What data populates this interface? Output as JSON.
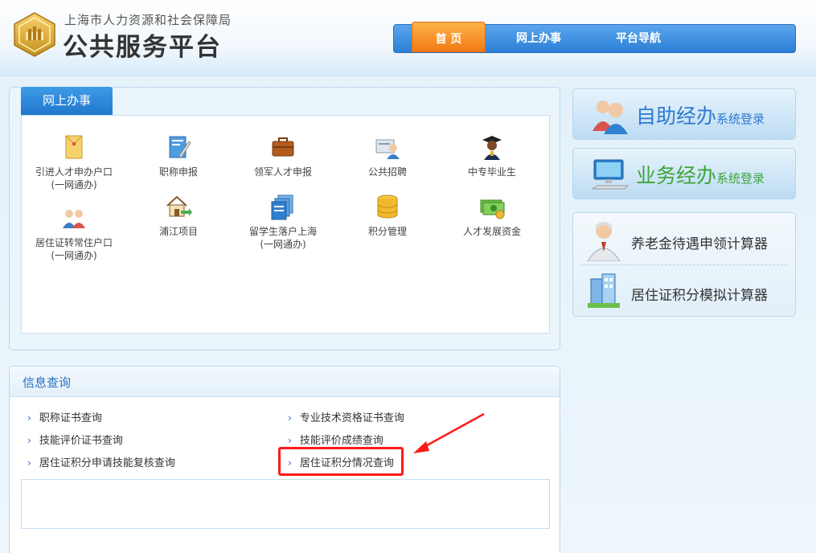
{
  "header": {
    "org_name": "上海市人力资源和社会保障局",
    "platform_name": "公共服务平台"
  },
  "nav": {
    "items": [
      {
        "label": "首 页",
        "active": true
      },
      {
        "label": "网上办事",
        "active": false
      },
      {
        "label": "平台导航",
        "active": false
      }
    ]
  },
  "online": {
    "tab_label": "网上办事",
    "services": [
      {
        "label": "引进人才申办户口",
        "sub": "(一网通办)",
        "icon": "document-envelope-icon"
      },
      {
        "label": "职称申报",
        "sub": "",
        "icon": "certificate-pen-icon"
      },
      {
        "label": "领军人才申报",
        "sub": "",
        "icon": "briefcase-icon"
      },
      {
        "label": "公共招聘",
        "sub": "",
        "icon": "recruitment-icon"
      },
      {
        "label": "中专毕业生",
        "sub": "",
        "icon": "graduate-icon"
      },
      {
        "label": "居住证转常住户口",
        "sub": "(一网通办)",
        "icon": "family-icon"
      },
      {
        "label": "浦江项目",
        "sub": "",
        "icon": "house-arrow-icon"
      },
      {
        "label": "留学生落户上海",
        "sub": "(一网通办)",
        "icon": "documents-stack-icon"
      },
      {
        "label": "积分管理",
        "sub": "",
        "icon": "database-icon"
      },
      {
        "label": "人才发展资金",
        "sub": "",
        "icon": "money-icon"
      }
    ]
  },
  "info": {
    "title": "信息查询",
    "links": [
      {
        "label": "职称证书查询"
      },
      {
        "label": "专业技术资格证书查询"
      },
      {
        "label": "技能评价证书查询"
      },
      {
        "label": "技能评价成绩查询"
      },
      {
        "label": "居住证积分申请技能复核查询"
      },
      {
        "label": "居住证积分情况查询"
      }
    ]
  },
  "right": {
    "self_service": {
      "big": "自助经办",
      "small": "系统登录"
    },
    "business": {
      "big": "业务经办",
      "small": "系统登录"
    },
    "calculators": [
      {
        "label": "养老金待遇申领计算器",
        "icon": "elderly-man-icon"
      },
      {
        "label": "居住证积分模拟计算器",
        "icon": "buildings-icon"
      }
    ]
  },
  "colors": {
    "nav_blue": "#2c7fd6",
    "nav_active_orange": "#f07a12",
    "link_blue": "#2a6fbf",
    "highlight_red": "#ff1a1a",
    "green_text": "#3ea53a"
  }
}
